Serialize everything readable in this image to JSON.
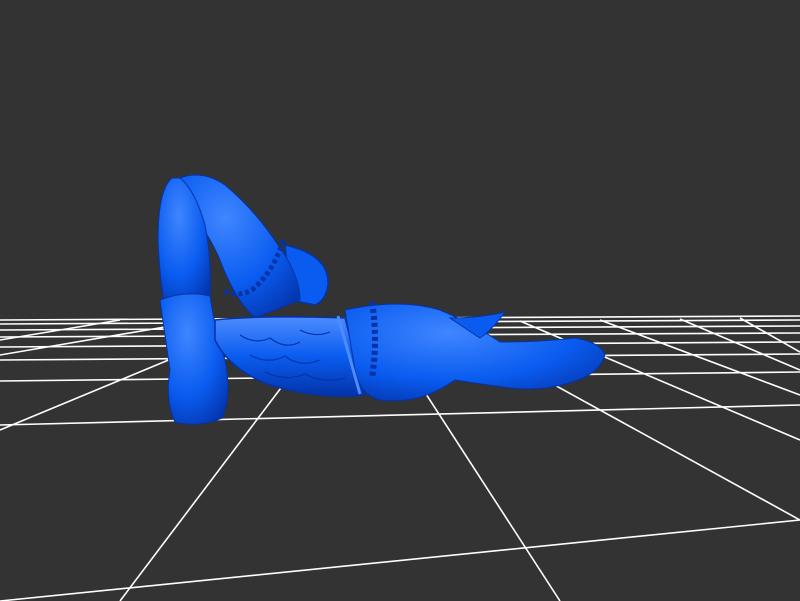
{
  "scene": {
    "background_color": "#333333",
    "grid_color": "#ffffff",
    "model_color": "#0a5cf0",
    "model_shadow_color": "#0433a8",
    "model_highlight_color": "#4d8cff",
    "grid_icon": "ground-grid",
    "model_icon": "reclining-figure-3d-model"
  }
}
